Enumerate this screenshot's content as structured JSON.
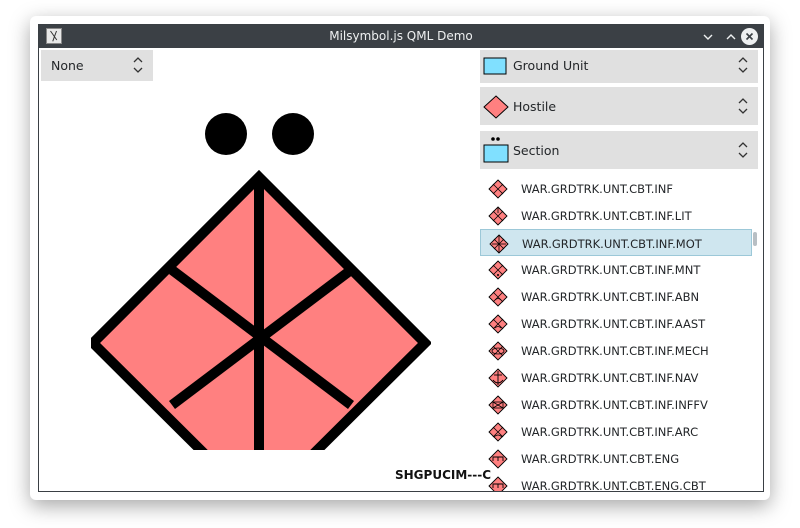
{
  "window": {
    "title": "Milsymbol.js QML Demo"
  },
  "left_combo": {
    "value": "None"
  },
  "dimension_combo": {
    "value": "Ground Unit"
  },
  "affiliation_combo": {
    "value": "Hostile"
  },
  "echelon_combo": {
    "value": "Section"
  },
  "preview": {
    "sidc_label": "SHGPUCIM---C"
  },
  "symbol_list": {
    "items": [
      "WAR.GRDTRK.UNT.CBT.INF",
      "WAR.GRDTRK.UNT.CBT.INF.LIT",
      "WAR.GRDTRK.UNT.CBT.INF.MOT",
      "WAR.GRDTRK.UNT.CBT.INF.MNT",
      "WAR.GRDTRK.UNT.CBT.INF.ABN",
      "WAR.GRDTRK.UNT.CBT.INF.AAST",
      "WAR.GRDTRK.UNT.CBT.INF.MECH",
      "WAR.GRDTRK.UNT.CBT.INF.NAV",
      "WAR.GRDTRK.UNT.CBT.INF.INFFV",
      "WAR.GRDTRK.UNT.CBT.INF.ARC",
      "WAR.GRDTRK.UNT.CBT.ENG",
      "WAR.GRDTRK.UNT.CBT.ENG.CBT"
    ],
    "selected_index": 2
  },
  "colors": {
    "hostile_fill": "#ff8080",
    "ground_unit_fill": "#80e0ff",
    "selection": "#cfe6ef"
  }
}
